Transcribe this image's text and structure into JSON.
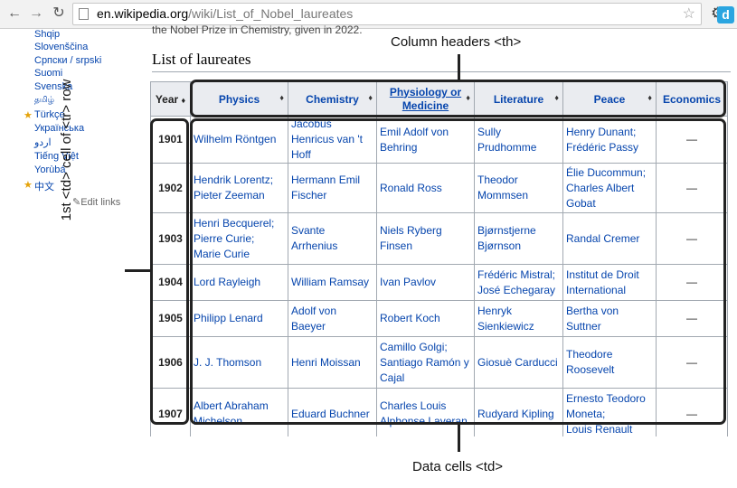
{
  "browser": {
    "url_host": "en.wikipedia.org",
    "url_path": "/wiki/List_of_Nobel_laureates",
    "extension_label": "d"
  },
  "sidebar": {
    "languages": [
      "Shqip",
      "Slovenščina",
      "Српски / srpski",
      "Suomi",
      "Svenska",
      "தமிழ்",
      "Türkçe",
      "Українська",
      "اردو",
      "Tiếng Việt",
      "Yorùbá",
      "中文"
    ],
    "edit_links": "Edit links"
  },
  "article": {
    "cut_text": "the Nobel Prize in Chemistry, given in 2022.",
    "section_title": "List of laureates"
  },
  "table": {
    "headers": [
      "Year",
      "Physics",
      "Chemistry",
      "Physiology or Medicine",
      "Literature",
      "Peace",
      "Economics"
    ],
    "rows": [
      {
        "year": "1901",
        "physics": [
          "Wilhelm Röntgen"
        ],
        "chemistry": [
          "Jacobus Henricus van 't Hoff"
        ],
        "medicine": [
          "Emil Adolf von Behring"
        ],
        "literature": [
          "Sully Prudhomme"
        ],
        "peace": [
          "Henry Dunant;",
          "Frédéric Passy"
        ],
        "economics": "—"
      },
      {
        "year": "1902",
        "physics": [
          "Hendrik Lorentz;",
          "Pieter Zeeman"
        ],
        "chemistry": [
          "Hermann Emil Fischer"
        ],
        "medicine": [
          "Ronald Ross"
        ],
        "literature": [
          "Theodor Mommsen"
        ],
        "peace": [
          "Élie Ducommun;",
          "Charles Albert Gobat"
        ],
        "economics": "—"
      },
      {
        "year": "1903",
        "physics": [
          "Henri Becquerel;",
          "Pierre Curie;",
          "Marie Curie"
        ],
        "chemistry": [
          "Svante Arrhenius"
        ],
        "medicine": [
          "Niels Ryberg Finsen"
        ],
        "literature": [
          "Bjørnstjerne Bjørnson"
        ],
        "peace": [
          "Randal Cremer"
        ],
        "economics": "—"
      },
      {
        "year": "1904",
        "physics": [
          "Lord Rayleigh"
        ],
        "chemistry": [
          "William Ramsay"
        ],
        "medicine": [
          "Ivan Pavlov"
        ],
        "literature": [
          "Frédéric Mistral;",
          "José Echegaray"
        ],
        "peace": [
          "Institut de Droit International"
        ],
        "economics": "—"
      },
      {
        "year": "1905",
        "physics": [
          "Philipp Lenard"
        ],
        "chemistry": [
          "Adolf von Baeyer"
        ],
        "medicine": [
          "Robert Koch"
        ],
        "literature": [
          "Henryk Sienkiewicz"
        ],
        "peace": [
          "Bertha von Suttner"
        ],
        "economics": "—"
      },
      {
        "year": "1906",
        "physics": [
          "J. J. Thomson"
        ],
        "chemistry": [
          "Henri Moissan"
        ],
        "medicine": [
          "Camillo Golgi;",
          "Santiago Ramón y Cajal"
        ],
        "literature": [
          "Giosuè Carducci"
        ],
        "peace": [
          "Theodore Roosevelt"
        ],
        "economics": "—"
      },
      {
        "year": "1907",
        "physics": [
          "Albert Abraham Michelson"
        ],
        "chemistry": [
          "Eduard Buchner"
        ],
        "medicine": [
          "Charles Louis Alphonse Laveran"
        ],
        "literature": [
          "Rudyard Kipling"
        ],
        "peace": [
          "Ernesto Teodoro Moneta;",
          "Louis Renault"
        ],
        "economics": "—"
      }
    ]
  },
  "annotations": {
    "column_headers": "Column headers <th>",
    "first_td": "1st <td> cell of <tr> row",
    "data_cells": "Data cells <td>"
  }
}
